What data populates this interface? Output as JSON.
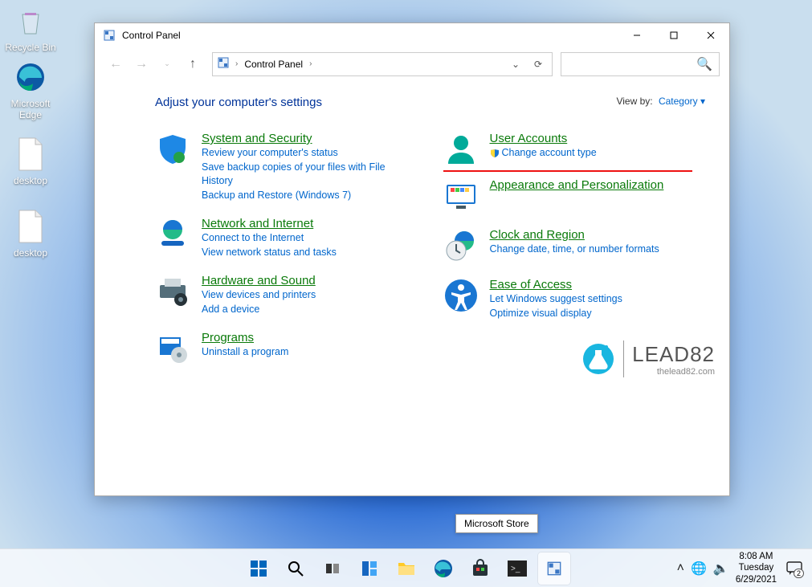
{
  "desktop": {
    "icons": [
      "Recycle Bin",
      "Microsoft Edge",
      "desktop",
      "desktop"
    ]
  },
  "window": {
    "title": "Control Panel",
    "breadcrumb": "Control Panel",
    "search_placeholder": "",
    "heading": "Adjust your computer's settings",
    "viewby_label": "View by:",
    "viewby_value": "Category",
    "categories_left": [
      {
        "title": "System and Security",
        "links": [
          "Review your computer's status",
          "Save backup copies of your files with File History",
          "Backup and Restore (Windows 7)"
        ]
      },
      {
        "title": "Network and Internet",
        "links": [
          "Connect to the Internet",
          "View network status and tasks"
        ]
      },
      {
        "title": "Hardware and Sound",
        "links": [
          "View devices and printers",
          "Add a device"
        ]
      },
      {
        "title": "Programs",
        "links": [
          "Uninstall a program"
        ]
      }
    ],
    "categories_right": [
      {
        "title": "User Accounts",
        "links": [
          "Change account type"
        ],
        "shield": true,
        "highlight": true
      },
      {
        "title": "Appearance and Personalization",
        "links": []
      },
      {
        "title": "Clock and Region",
        "links": [
          "Change date, time, or number formats"
        ]
      },
      {
        "title": "Ease of Access",
        "links": [
          "Let Windows suggest settings",
          "Optimize visual display"
        ]
      }
    ]
  },
  "watermark": {
    "brand": "LEAD82",
    "url": "thelead82.com"
  },
  "tooltip": "Microsoft Store",
  "taskbar": {
    "tray": {
      "time": "8:08 AM",
      "day": "Tuesday",
      "date": "6/29/2021",
      "notif_count": "2"
    }
  }
}
